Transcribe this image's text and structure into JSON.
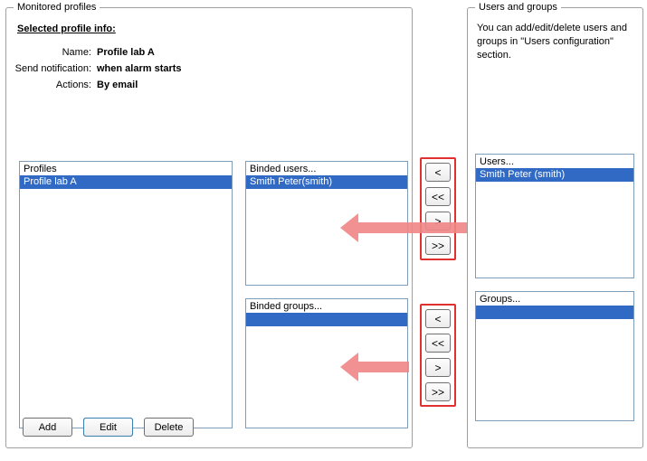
{
  "monitored": {
    "legend": "Monitored profiles",
    "info_title": "Selected profile info:",
    "name_label": "Name:",
    "name_value": "Profile lab A",
    "notify_label": "Send notification:",
    "notify_value": "when alarm starts",
    "actions_label": "Actions:",
    "actions_value": "By email",
    "profiles_header": "Profiles",
    "profiles_item": "Profile lab A",
    "binded_users_header": "Binded users...",
    "binded_users_item": "Smith Peter(smith)",
    "binded_groups_header": "Binded groups...",
    "add_label": "Add",
    "edit_label": "Edit",
    "delete_label": "Delete"
  },
  "transfer": {
    "move_left": "<",
    "move_all_left": "<<",
    "move_right": ">",
    "move_all_right": ">>"
  },
  "usersgroups": {
    "legend": "Users and groups",
    "help": "You can add/edit/delete users and groups in \"Users configuration\" section.",
    "users_header": "Users...",
    "users_item": "Smith Peter (smith)",
    "groups_header": "Groups..."
  }
}
